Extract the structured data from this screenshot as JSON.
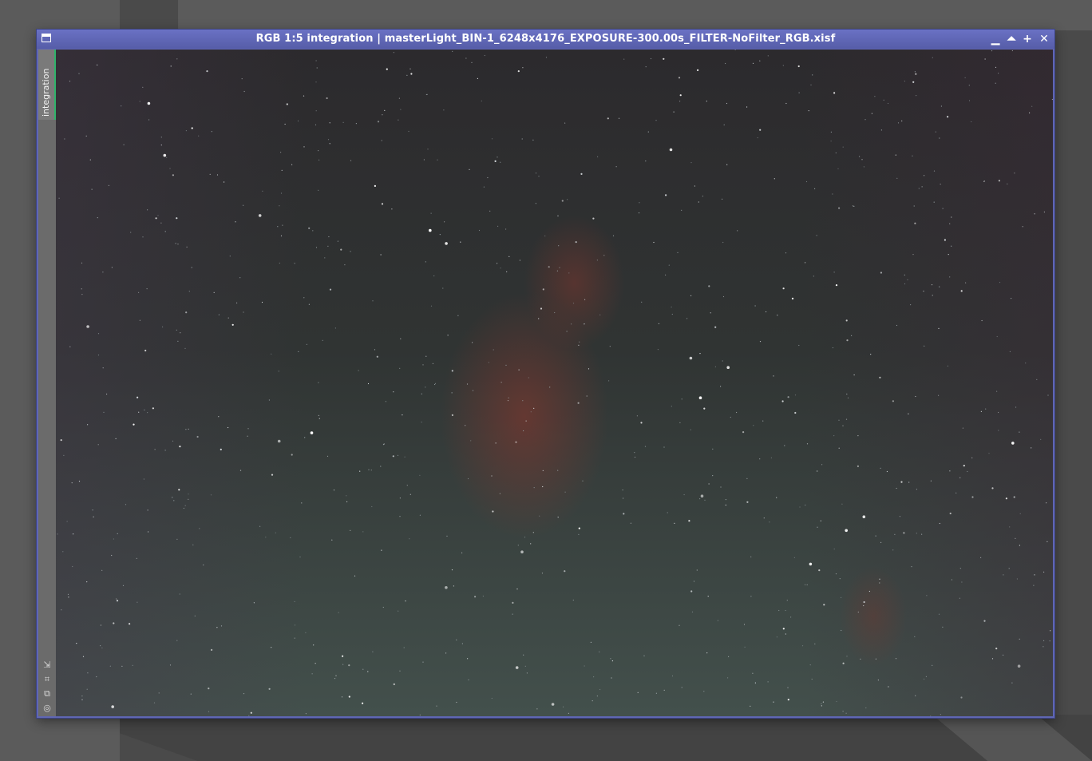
{
  "window": {
    "title": "RGB 1:5 integration | masterLight_BIN-1_6248x4176_EXPOSURE-300.00s_FILTER-NoFilter_RGB.xisf",
    "buttons": {
      "minimize": "▁",
      "shade": "⏶",
      "maximize": "+",
      "close": "✕"
    }
  },
  "sidebar": {
    "tab_label": "integration",
    "tools": [
      {
        "name": "zoom-fit-icon",
        "glyph": "⇲"
      },
      {
        "name": "fit-view-icon",
        "glyph": "⌗"
      },
      {
        "name": "clone-icon",
        "glyph": "⧉"
      },
      {
        "name": "target-icon",
        "glyph": "◎"
      }
    ]
  },
  "image": {
    "description_colors": {
      "sky_top": "#2c2a2d",
      "sky_bottom": "#43504c",
      "nebula": "#8c372d",
      "title_bar": "#5f66b4",
      "tab_accent": "#2fb36a"
    }
  }
}
